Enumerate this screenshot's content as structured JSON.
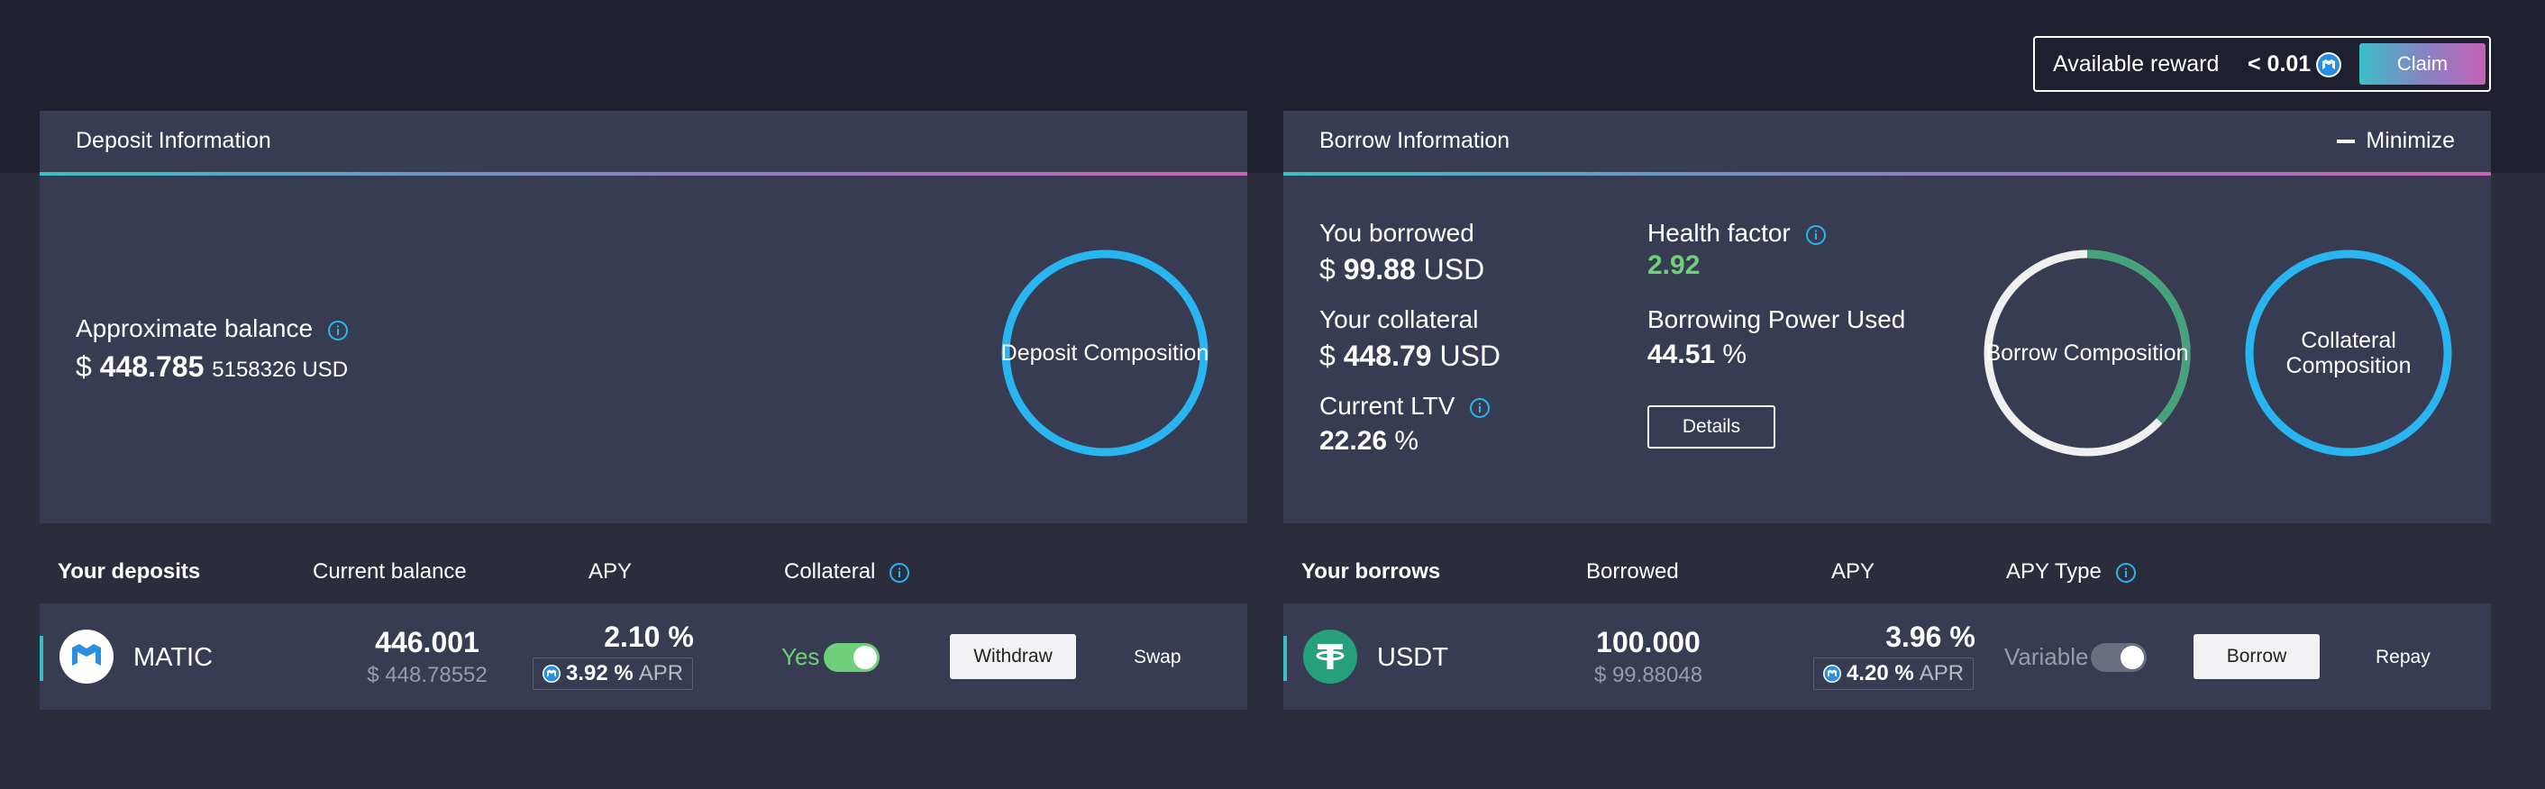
{
  "reward": {
    "label": "Available reward",
    "value": "< 0.01",
    "icon": "matic-icon",
    "claim_label": "Claim"
  },
  "deposit_panel": {
    "title": "Deposit Information",
    "approx_balance_label": "Approximate balance",
    "balance_currency": "$",
    "balance_main": "448.785",
    "balance_rest": "5158326 USD",
    "composition_label": "Deposit Composition",
    "composition_color": "#29b6f0"
  },
  "borrow_panel": {
    "title": "Borrow Information",
    "minimize_label": "Minimize",
    "you_borrowed_label": "You borrowed",
    "you_borrowed_prefix": "$",
    "you_borrowed_value": "99.88",
    "you_borrowed_unit": "USD",
    "collateral_label": "Your collateral",
    "collateral_prefix": "$",
    "collateral_value": "448.79",
    "collateral_unit": "USD",
    "ltv_label": "Current LTV",
    "ltv_value": "22.26",
    "ltv_unit": "%",
    "health_label": "Health factor",
    "health_value": "2.92",
    "power_label": "Borrowing Power Used",
    "power_value": "44.51",
    "power_unit": "%",
    "details_label": "Details",
    "borrow_composition_label": "Borrow Composition",
    "borrow_composition_fraction": 0.37,
    "borrow_composition_colors": [
      "#45a27a",
      "#f0f0f0"
    ],
    "collateral_composition_label": "Collateral Composition",
    "collateral_composition_color": "#29b6f0"
  },
  "deposits_table": {
    "headers": [
      "Your deposits",
      "Current balance",
      "APY",
      "Collateral"
    ],
    "row": {
      "asset": "MATIC",
      "asset_icon": "matic-icon",
      "balance": "446.001",
      "balance_usd": "$ 448.78552",
      "apy": "2.10 %",
      "apr_value": "3.92 %",
      "apr_label": "APR",
      "collateral_label": "Yes",
      "collateral_on": true,
      "withdraw_label": "Withdraw",
      "swap_label": "Swap"
    }
  },
  "borrows_table": {
    "headers": [
      "Your borrows",
      "Borrowed",
      "APY",
      "APY Type"
    ],
    "row": {
      "asset": "USDT",
      "asset_icon": "tether-icon",
      "borrowed": "100.000",
      "borrowed_usd": "$ 99.88048",
      "apy": "3.96 %",
      "apr_value": "4.20 %",
      "apr_label": "APR",
      "apy_type_label": "Variable",
      "apy_type_on": false,
      "borrow_label": "Borrow",
      "repay_label": "Repay"
    }
  },
  "colors": {
    "accent_teal": "#3cbec6",
    "accent_pink": "#c662b4",
    "green": "#6fcf7a",
    "info_blue": "#29b6f0"
  }
}
